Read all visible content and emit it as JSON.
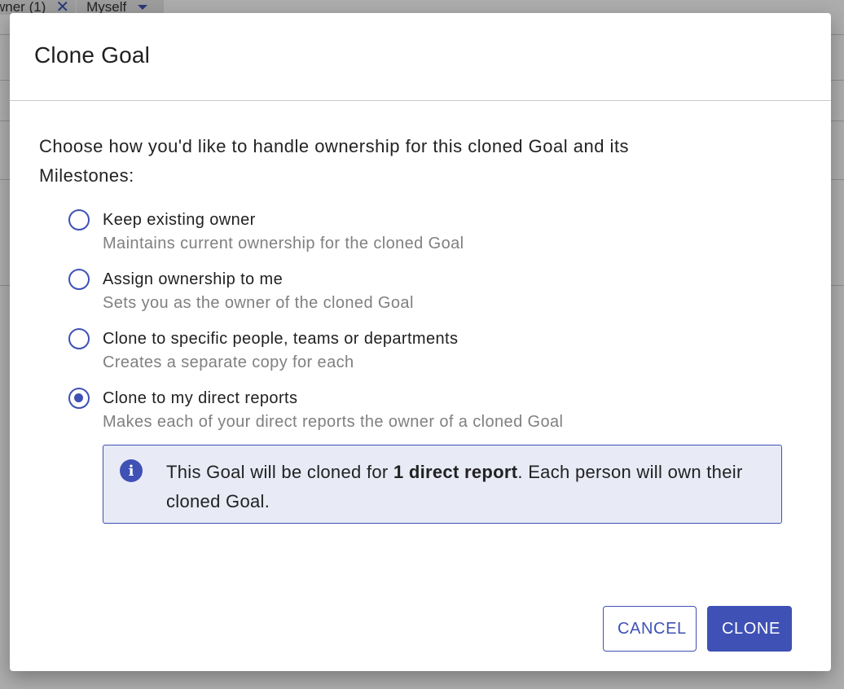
{
  "background": {
    "filter_chip": {
      "label": "wner (1)",
      "remove_icon": "close-icon"
    },
    "owner_select": {
      "value": "Myself",
      "icon": "caret-down-icon"
    }
  },
  "dialog": {
    "title": "Clone Goal",
    "prompt": "Choose how you'd like to handle ownership for this cloned Goal and its Milestones:",
    "options": [
      {
        "label": "Keep existing owner",
        "description": "Maintains current ownership for the cloned Goal",
        "selected": false
      },
      {
        "label": "Assign ownership to me",
        "description": "Sets you as the owner of the cloned Goal",
        "selected": false
      },
      {
        "label": "Clone to specific people, teams or departments",
        "description": "Creates a separate copy for each",
        "selected": false
      },
      {
        "label": "Clone to my direct reports",
        "description": "Makes each of your direct reports the owner of a cloned Goal",
        "selected": true
      }
    ],
    "info": {
      "icon": "info-icon",
      "text_before": "This Goal will be cloned for ",
      "text_bold": "1 direct report",
      "text_after": ". Each person will own their cloned Goal."
    },
    "buttons": {
      "cancel_label": "CANCEL",
      "clone_label": "CLONE"
    }
  },
  "colors": {
    "accent": "#3f51b5",
    "info_background": "#e8eaf6",
    "description_text": "#808080"
  }
}
